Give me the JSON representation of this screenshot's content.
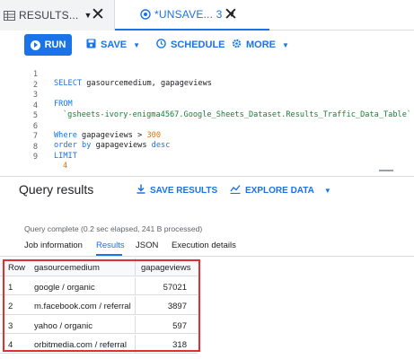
{
  "tabs": [
    {
      "label": "RESULTS...",
      "icon": "grid-icon"
    },
    {
      "label": "*UNSAVE... 3",
      "icon": "query-icon"
    }
  ],
  "toolbar": {
    "run_label": "RUN",
    "save_label": "SAVE",
    "schedule_label": "SCHEDULE",
    "more_label": "MORE"
  },
  "editor": {
    "line_numbers": [
      "1",
      "2",
      "3",
      "4",
      "5",
      "6",
      "7",
      "8",
      "9"
    ],
    "line1": {
      "kw": "SELECT",
      "rest": " gasourcemedium, gapageviews"
    },
    "line3": {
      "kw": "FROM"
    },
    "line4": {
      "str": "`gsheets-ivory-enigma4567.Google_Sheets_Dataset.Results_Traffic_Data_Table`"
    },
    "line6": {
      "kw": "Where",
      "rest": " gapageviews > ",
      "num": "300"
    },
    "line7": {
      "kw": "order by",
      "rest": " gapageviews ",
      "kw2": "desc"
    },
    "line8": {
      "kw": "LIMIT"
    },
    "line9": {
      "num": "4"
    }
  },
  "results": {
    "title": "Query results",
    "save_results_label": "SAVE RESULTS",
    "explore_data_label": "EXPLORE DATA",
    "status": "Query complete (0.2 sec elapsed, 241 B processed)",
    "subtabs": [
      "Job information",
      "Results",
      "JSON",
      "Execution details"
    ],
    "active_subtab": "Results"
  },
  "table": {
    "headers": [
      "Row",
      "gasourcemedium",
      "gapageviews"
    ],
    "rows": [
      {
        "row": "1",
        "source": "google / organic",
        "pageviews": "57021"
      },
      {
        "row": "2",
        "source": "m.facebook.com / referral",
        "pageviews": "3897"
      },
      {
        "row": "3",
        "source": "yahoo / organic",
        "pageviews": "597"
      },
      {
        "row": "4",
        "source": "orbitmedia.com / referral",
        "pageviews": "318"
      }
    ]
  },
  "colors": {
    "accent": "#1a73e8",
    "highlight": "#e02f2f",
    "string": "#188038",
    "number": "#e8710a"
  }
}
